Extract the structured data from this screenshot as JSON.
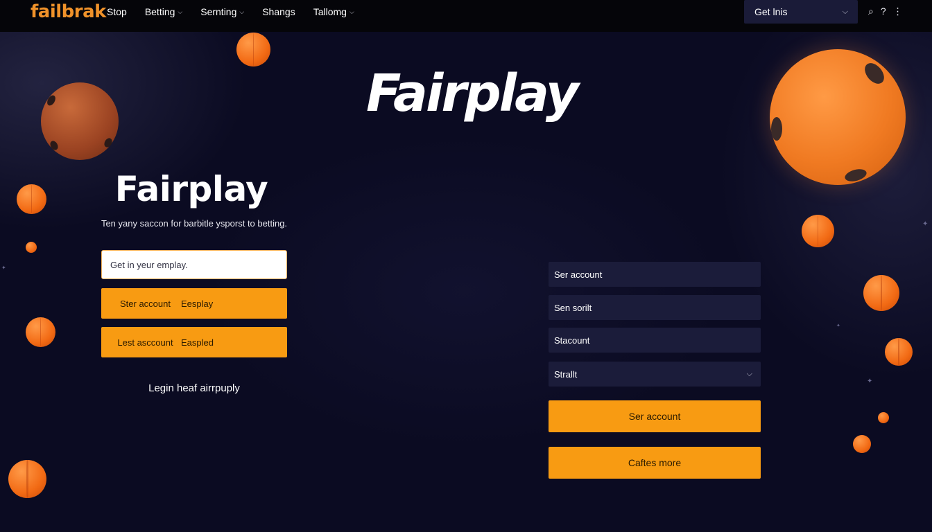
{
  "navbar": {
    "logo": "failbrak",
    "items": [
      {
        "label": "Stop",
        "has_dropdown": false
      },
      {
        "label": "Betting",
        "has_dropdown": true
      },
      {
        "label": "Sernting",
        "has_dropdown": true
      },
      {
        "label": "Shangs",
        "has_dropdown": false
      },
      {
        "label": "Tallomg",
        "has_dropdown": true
      }
    ],
    "select_label": "Get lnis",
    "icons": [
      "search-icon",
      "help-icon",
      "more-vertical-icon"
    ],
    "icon_glyphs": {
      "search": "⌕",
      "help": "?",
      "more": "⋮"
    }
  },
  "hero": {
    "title": "Fairplay"
  },
  "left_panel": {
    "title": "Fairplay",
    "subtitle": "Ten yany saccon for barbitle ysporst to betting.",
    "email_placeholder": "Get in yeur emplay.",
    "buttons": [
      {
        "label": "Ster account",
        "label2": "Eesplay"
      },
      {
        "label": "Lest asccount",
        "label2": "Easpled"
      }
    ],
    "login_link": "Legin heaf airrpuply"
  },
  "right_panel": {
    "fields": [
      {
        "label": "Ser account",
        "dropdown": false
      },
      {
        "label": "Sen sorilt",
        "dropdown": false
      },
      {
        "label": "Stacount",
        "dropdown": false
      },
      {
        "label": "Strallt",
        "dropdown": true
      }
    ],
    "primary_button": "Ser account",
    "secondary_button": "Caftes more"
  },
  "colors": {
    "background": "#0b0b22",
    "navbar": "#050509",
    "accent_orange": "#f89b12",
    "logo_orange": "#f0922a",
    "field_bg": "#1b1c3a"
  }
}
